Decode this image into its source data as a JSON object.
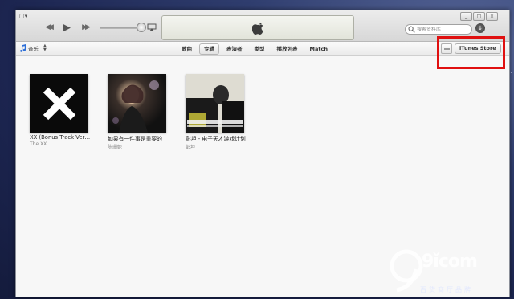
{
  "toolbar": {
    "lcd_logo": "apple-logo",
    "search_placeholder": "搜索资料库",
    "window_buttons": [
      "_",
      "□",
      "×"
    ]
  },
  "subbar": {
    "library": "音乐",
    "tabs": [
      {
        "label": "歌曲",
        "active": false
      },
      {
        "label": "专辑",
        "active": true
      },
      {
        "label": "表演者",
        "active": false
      },
      {
        "label": "类型",
        "active": false
      },
      {
        "label": "播放列表",
        "active": false
      },
      {
        "label": "Match",
        "active": false
      }
    ],
    "store_button": "iTunes Store"
  },
  "albums": [
    {
      "title": "XX (Bonus Track Versi...",
      "artist": "The XX"
    },
    {
      "title": "如果有一件事是重要的",
      "artist": "陈珊妮"
    },
    {
      "title": "彭坦 - 电子天才游戏计划",
      "artist": "彭坦"
    }
  ],
  "watermark": {
    "brand": "9ǐcom",
    "tagline": "百货商厅品牌"
  },
  "colors": {
    "highlight": "#e01010",
    "desktop": "#1c2550"
  }
}
